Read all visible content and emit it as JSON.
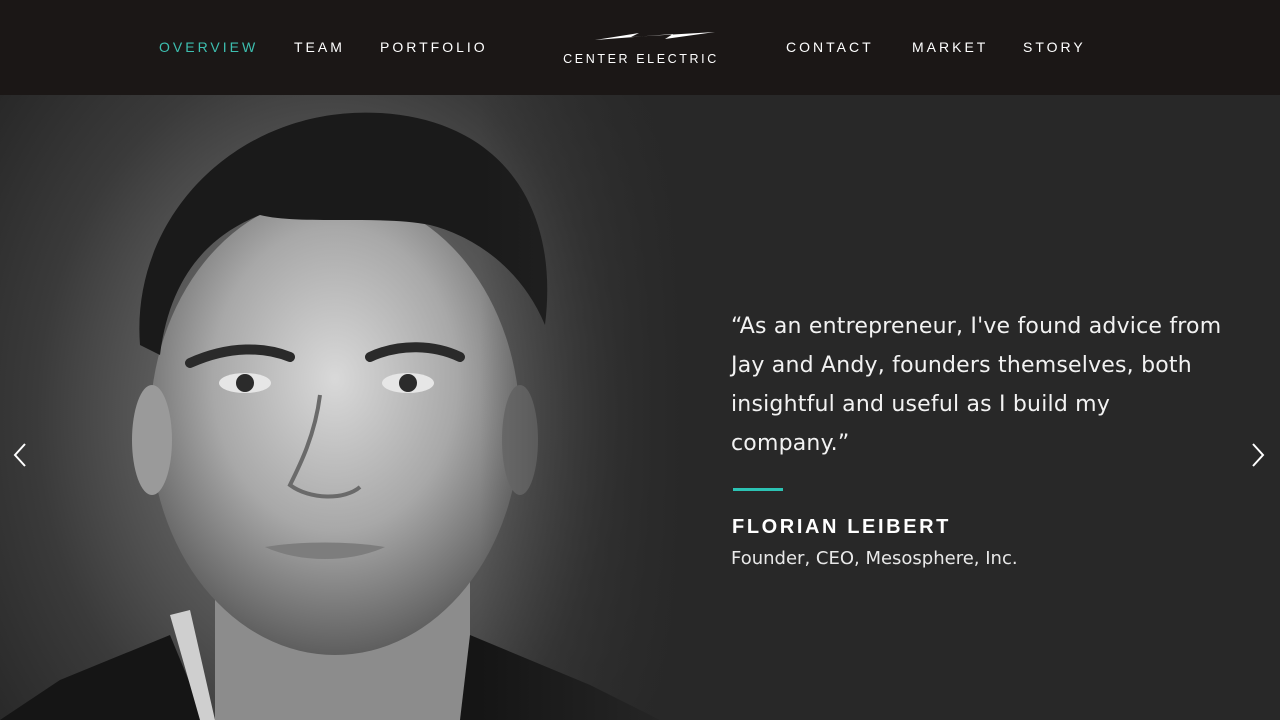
{
  "nav": {
    "left_items": [
      {
        "label": "OVERVIEW",
        "active": true
      },
      {
        "label": "TEAM",
        "active": false
      },
      {
        "label": "PORTFOLIO",
        "active": false
      }
    ],
    "right_items": [
      {
        "label": "CONTACT",
        "active": false
      },
      {
        "label": "MARKET",
        "active": false
      },
      {
        "label": "STORY",
        "active": false
      }
    ],
    "logo_text": "CENTER ELECTRIC",
    "logo_icon": "lightning-bolt-icon"
  },
  "testimonial": {
    "quote": "“As an entrepreneur, I've found advice from Jay and Andy, founders themselves, both insightful and useful as I build my company.”",
    "name": "FLORIAN LEIBERT",
    "title": "Founder, CEO, Mesosphere, Inc."
  },
  "carousel": {
    "prev_icon": "chevron-left-icon",
    "next_icon": "chevron-right-icon"
  },
  "colors": {
    "header_bg": "#1b1716",
    "hero_bg": "#282828",
    "accent": "#3dbfb0",
    "text": "#ffffff"
  }
}
